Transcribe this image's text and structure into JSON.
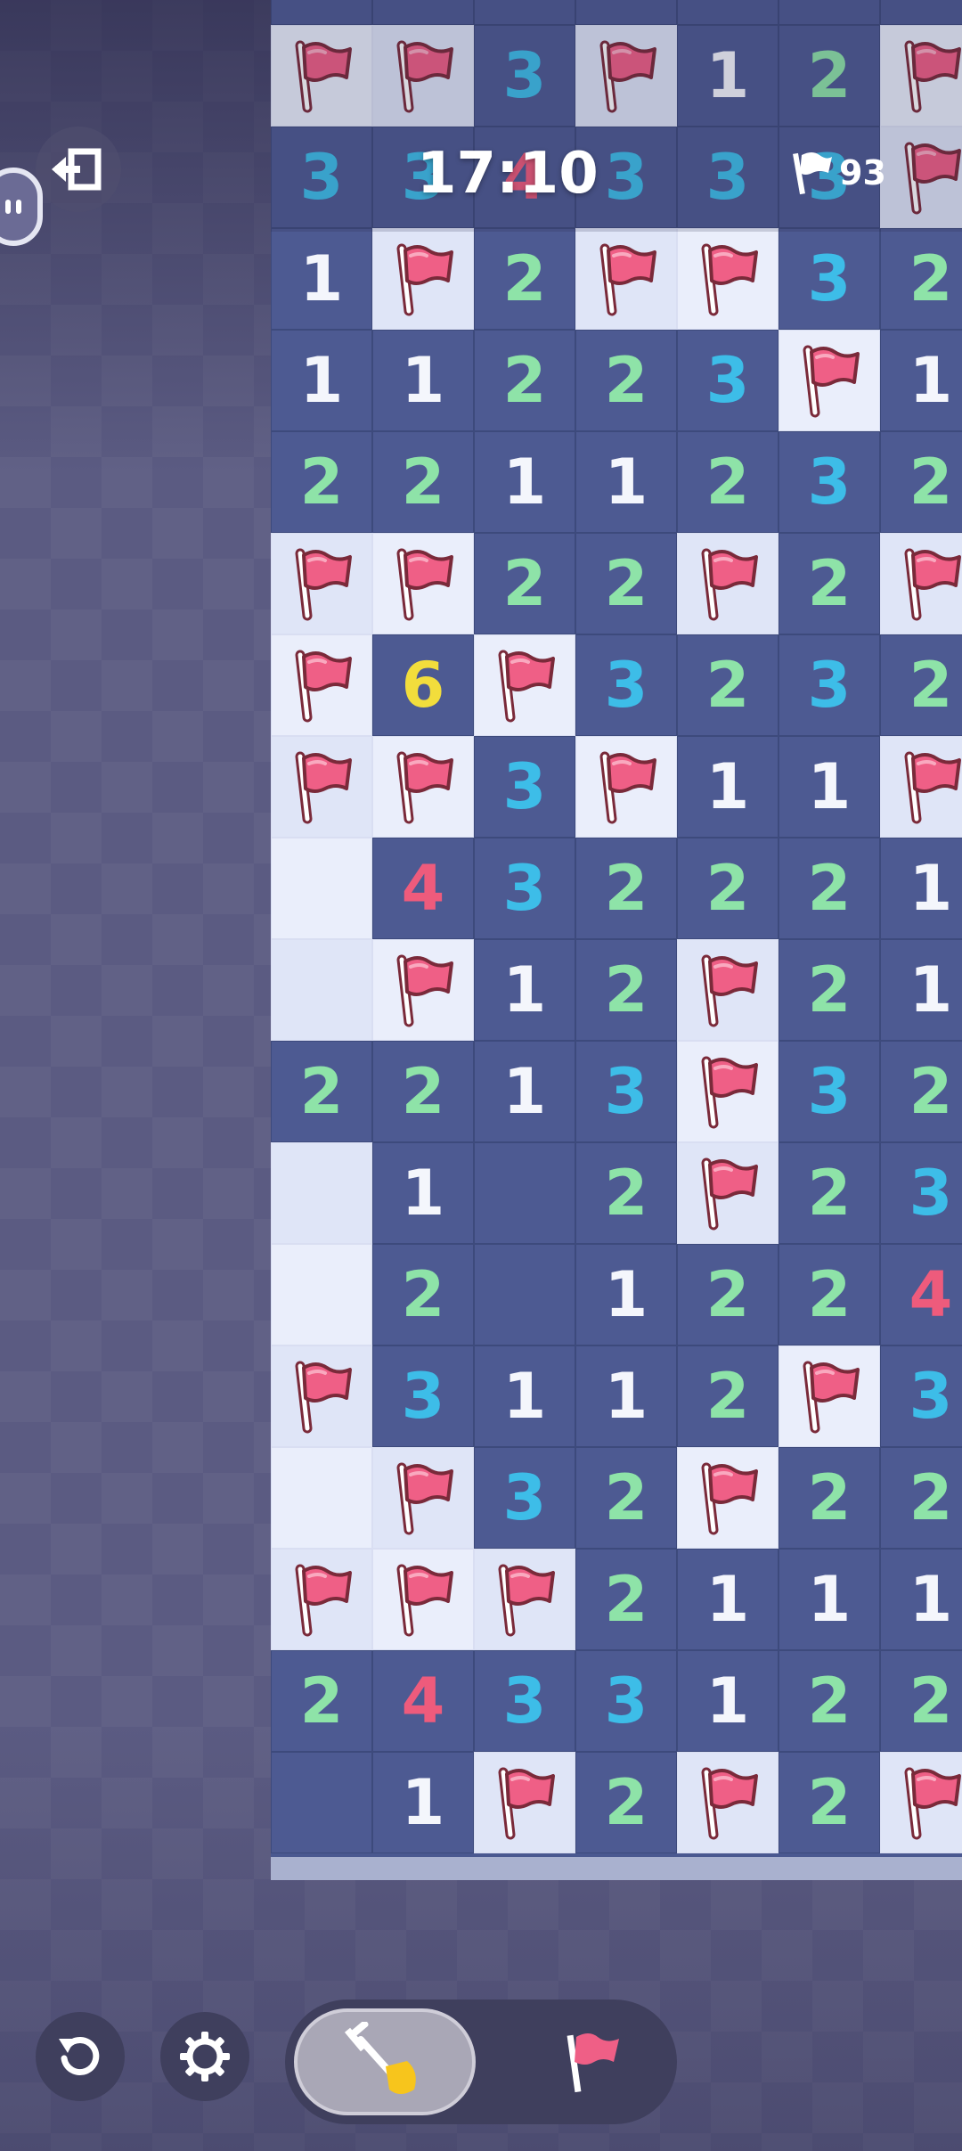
{
  "hud": {
    "timer": "17:10",
    "flags_remaining": "93"
  },
  "board": {
    "columns": 7,
    "legend": "H = unrevealed, E = revealed empty, F = flag, digit = adjacent mine count",
    "rows": [
      [
        "H",
        "H",
        "H",
        "H",
        "H",
        "H",
        "H"
      ],
      [
        "F",
        "F",
        "3",
        "F",
        "1",
        "2",
        "F"
      ],
      [
        "3",
        "3",
        "4",
        "3",
        "3",
        "3",
        "F"
      ],
      [
        "1",
        "F",
        "2",
        "F",
        "F",
        "3",
        "2"
      ],
      [
        "1",
        "1",
        "2",
        "2",
        "3",
        "F",
        "1"
      ],
      [
        "2",
        "2",
        "1",
        "1",
        "2",
        "3",
        "2"
      ],
      [
        "F",
        "F",
        "2",
        "2",
        "F",
        "2",
        "F"
      ],
      [
        "F",
        "6",
        "F",
        "3",
        "2",
        "3",
        "2"
      ],
      [
        "F",
        "F",
        "3",
        "F",
        "1",
        "1",
        "F"
      ],
      [
        "E",
        "4",
        "3",
        "2",
        "2",
        "2",
        "1"
      ],
      [
        "E",
        "F",
        "1",
        "2",
        "F",
        "2",
        "1"
      ],
      [
        "2",
        "2",
        "1",
        "3",
        "F",
        "3",
        "2"
      ],
      [
        "E",
        "1",
        "H",
        "2",
        "F",
        "2",
        "3"
      ],
      [
        "E",
        "2",
        "H",
        "1",
        "2",
        "2",
        "4"
      ],
      [
        "F",
        "3",
        "1",
        "1",
        "2",
        "F",
        "3"
      ],
      [
        "E",
        "F",
        "3",
        "2",
        "F",
        "2",
        "2"
      ],
      [
        "F",
        "F",
        "F",
        "2",
        "1",
        "1",
        "1"
      ],
      [
        "2",
        "4",
        "3",
        "3",
        "1",
        "2",
        "2"
      ],
      [
        "H",
        "1",
        "F",
        "2",
        "F",
        "2",
        "F"
      ]
    ]
  },
  "controls": {
    "exit_icon": "exit-icon",
    "restart_icon": "restart-icon",
    "settings_icon": "gear-icon",
    "dig_mode_icon": "shovel-icon",
    "flag_mode_icon": "flag-icon",
    "active_mode": "dig"
  },
  "colors": {
    "n1": "#f4f6fc",
    "n2": "#8ee3a8",
    "n3": "#3dbde8",
    "n4": "#ee5b7c",
    "n6": "#f2dd3c",
    "flag": "#ef5f86",
    "hidden_cell": "#4d5a92",
    "open_cell": "#eaeefb"
  }
}
